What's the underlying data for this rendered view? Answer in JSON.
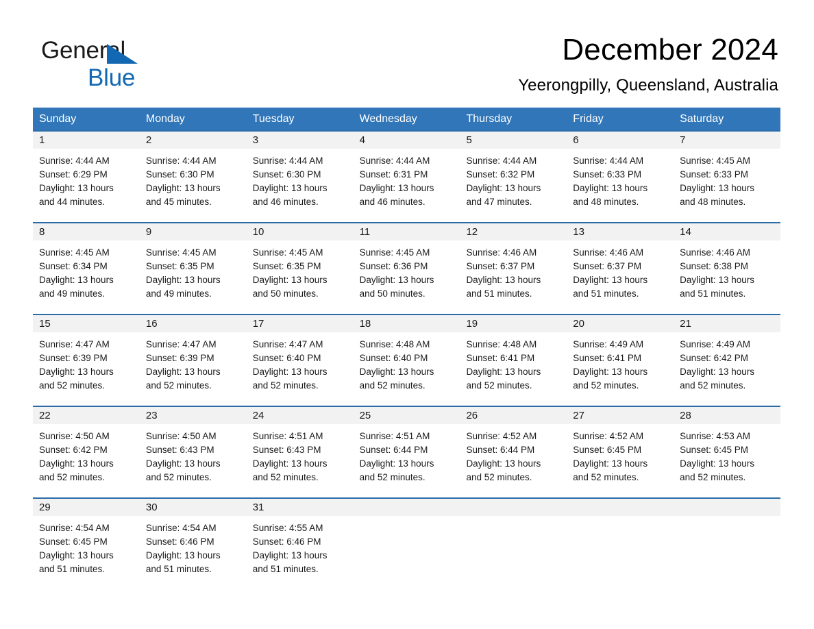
{
  "brand": {
    "name_part1": "General",
    "name_part2": "Blue",
    "accent_color": "#1268b3"
  },
  "header": {
    "title": "December 2024",
    "location": "Yeerongpilly, Queensland, Australia",
    "header_bg_color": "#3076b8",
    "row_divider_color": "#2b6ca8",
    "daynum_band_color": "#f2f2f2"
  },
  "weekdays": [
    "Sunday",
    "Monday",
    "Tuesday",
    "Wednesday",
    "Thursday",
    "Friday",
    "Saturday"
  ],
  "weeks": [
    {
      "days": [
        {
          "num": "1",
          "sunrise": "Sunrise: 4:44 AM",
          "sunset": "Sunset: 6:29 PM",
          "daylight": "Daylight: 13 hours and 44 minutes."
        },
        {
          "num": "2",
          "sunrise": "Sunrise: 4:44 AM",
          "sunset": "Sunset: 6:30 PM",
          "daylight": "Daylight: 13 hours and 45 minutes."
        },
        {
          "num": "3",
          "sunrise": "Sunrise: 4:44 AM",
          "sunset": "Sunset: 6:30 PM",
          "daylight": "Daylight: 13 hours and 46 minutes."
        },
        {
          "num": "4",
          "sunrise": "Sunrise: 4:44 AM",
          "sunset": "Sunset: 6:31 PM",
          "daylight": "Daylight: 13 hours and 46 minutes."
        },
        {
          "num": "5",
          "sunrise": "Sunrise: 4:44 AM",
          "sunset": "Sunset: 6:32 PM",
          "daylight": "Daylight: 13 hours and 47 minutes."
        },
        {
          "num": "6",
          "sunrise": "Sunrise: 4:44 AM",
          "sunset": "Sunset: 6:33 PM",
          "daylight": "Daylight: 13 hours and 48 minutes."
        },
        {
          "num": "7",
          "sunrise": "Sunrise: 4:45 AM",
          "sunset": "Sunset: 6:33 PM",
          "daylight": "Daylight: 13 hours and 48 minutes."
        }
      ]
    },
    {
      "days": [
        {
          "num": "8",
          "sunrise": "Sunrise: 4:45 AM",
          "sunset": "Sunset: 6:34 PM",
          "daylight": "Daylight: 13 hours and 49 minutes."
        },
        {
          "num": "9",
          "sunrise": "Sunrise: 4:45 AM",
          "sunset": "Sunset: 6:35 PM",
          "daylight": "Daylight: 13 hours and 49 minutes."
        },
        {
          "num": "10",
          "sunrise": "Sunrise: 4:45 AM",
          "sunset": "Sunset: 6:35 PM",
          "daylight": "Daylight: 13 hours and 50 minutes."
        },
        {
          "num": "11",
          "sunrise": "Sunrise: 4:45 AM",
          "sunset": "Sunset: 6:36 PM",
          "daylight": "Daylight: 13 hours and 50 minutes."
        },
        {
          "num": "12",
          "sunrise": "Sunrise: 4:46 AM",
          "sunset": "Sunset: 6:37 PM",
          "daylight": "Daylight: 13 hours and 51 minutes."
        },
        {
          "num": "13",
          "sunrise": "Sunrise: 4:46 AM",
          "sunset": "Sunset: 6:37 PM",
          "daylight": "Daylight: 13 hours and 51 minutes."
        },
        {
          "num": "14",
          "sunrise": "Sunrise: 4:46 AM",
          "sunset": "Sunset: 6:38 PM",
          "daylight": "Daylight: 13 hours and 51 minutes."
        }
      ]
    },
    {
      "days": [
        {
          "num": "15",
          "sunrise": "Sunrise: 4:47 AM",
          "sunset": "Sunset: 6:39 PM",
          "daylight": "Daylight: 13 hours and 52 minutes."
        },
        {
          "num": "16",
          "sunrise": "Sunrise: 4:47 AM",
          "sunset": "Sunset: 6:39 PM",
          "daylight": "Daylight: 13 hours and 52 minutes."
        },
        {
          "num": "17",
          "sunrise": "Sunrise: 4:47 AM",
          "sunset": "Sunset: 6:40 PM",
          "daylight": "Daylight: 13 hours and 52 minutes."
        },
        {
          "num": "18",
          "sunrise": "Sunrise: 4:48 AM",
          "sunset": "Sunset: 6:40 PM",
          "daylight": "Daylight: 13 hours and 52 minutes."
        },
        {
          "num": "19",
          "sunrise": "Sunrise: 4:48 AM",
          "sunset": "Sunset: 6:41 PM",
          "daylight": "Daylight: 13 hours and 52 minutes."
        },
        {
          "num": "20",
          "sunrise": "Sunrise: 4:49 AM",
          "sunset": "Sunset: 6:41 PM",
          "daylight": "Daylight: 13 hours and 52 minutes."
        },
        {
          "num": "21",
          "sunrise": "Sunrise: 4:49 AM",
          "sunset": "Sunset: 6:42 PM",
          "daylight": "Daylight: 13 hours and 52 minutes."
        }
      ]
    },
    {
      "days": [
        {
          "num": "22",
          "sunrise": "Sunrise: 4:50 AM",
          "sunset": "Sunset: 6:42 PM",
          "daylight": "Daylight: 13 hours and 52 minutes."
        },
        {
          "num": "23",
          "sunrise": "Sunrise: 4:50 AM",
          "sunset": "Sunset: 6:43 PM",
          "daylight": "Daylight: 13 hours and 52 minutes."
        },
        {
          "num": "24",
          "sunrise": "Sunrise: 4:51 AM",
          "sunset": "Sunset: 6:43 PM",
          "daylight": "Daylight: 13 hours and 52 minutes."
        },
        {
          "num": "25",
          "sunrise": "Sunrise: 4:51 AM",
          "sunset": "Sunset: 6:44 PM",
          "daylight": "Daylight: 13 hours and 52 minutes."
        },
        {
          "num": "26",
          "sunrise": "Sunrise: 4:52 AM",
          "sunset": "Sunset: 6:44 PM",
          "daylight": "Daylight: 13 hours and 52 minutes."
        },
        {
          "num": "27",
          "sunrise": "Sunrise: 4:52 AM",
          "sunset": "Sunset: 6:45 PM",
          "daylight": "Daylight: 13 hours and 52 minutes."
        },
        {
          "num": "28",
          "sunrise": "Sunrise: 4:53 AM",
          "sunset": "Sunset: 6:45 PM",
          "daylight": "Daylight: 13 hours and 52 minutes."
        }
      ]
    },
    {
      "days": [
        {
          "num": "29",
          "sunrise": "Sunrise: 4:54 AM",
          "sunset": "Sunset: 6:45 PM",
          "daylight": "Daylight: 13 hours and 51 minutes."
        },
        {
          "num": "30",
          "sunrise": "Sunrise: 4:54 AM",
          "sunset": "Sunset: 6:46 PM",
          "daylight": "Daylight: 13 hours and 51 minutes."
        },
        {
          "num": "31",
          "sunrise": "Sunrise: 4:55 AM",
          "sunset": "Sunset: 6:46 PM",
          "daylight": "Daylight: 13 hours and 51 minutes."
        },
        {
          "num": "",
          "sunrise": "",
          "sunset": "",
          "daylight": ""
        },
        {
          "num": "",
          "sunrise": "",
          "sunset": "",
          "daylight": ""
        },
        {
          "num": "",
          "sunrise": "",
          "sunset": "",
          "daylight": ""
        },
        {
          "num": "",
          "sunrise": "",
          "sunset": "",
          "daylight": ""
        }
      ]
    }
  ]
}
